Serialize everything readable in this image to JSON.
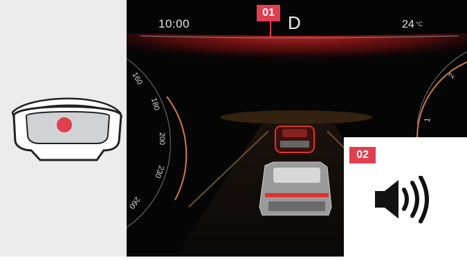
{
  "dashboard": {
    "time": "10:00",
    "gear": "D",
    "temperature": "24",
    "temperature_unit": "°C"
  },
  "callouts": {
    "badge_1": "01",
    "badge_2": "02"
  },
  "speedometer_ticks": [
    "160",
    "180",
    "200",
    "230",
    "260"
  ],
  "right_gauge_ticks": [
    "1",
    "2"
  ],
  "colors": {
    "accent_red": "#e03f4f",
    "dash_background": "#050505",
    "side_panel": "#ececec"
  },
  "icons": {
    "cluster": "instrument-cluster-icon",
    "speaker": "speaker-volume-icon"
  }
}
